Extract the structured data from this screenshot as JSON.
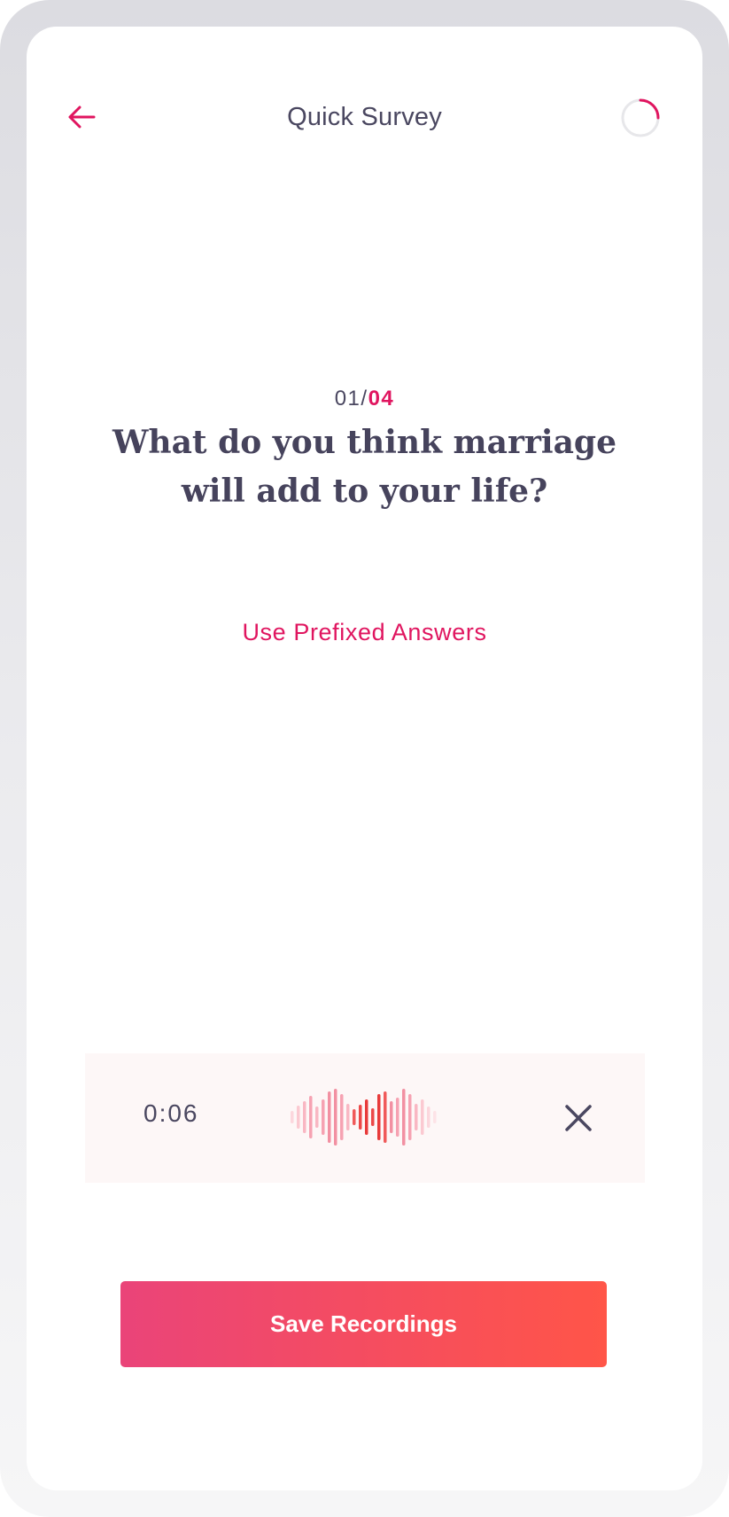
{
  "header": {
    "title": "Quick Survey",
    "back_icon": "arrow-left-icon",
    "progress_icon": "progress-ring-icon",
    "progress_fraction": 0.25
  },
  "question": {
    "current": "01/",
    "total": "04",
    "text": "What do you think marriage will add to your life?"
  },
  "prefixed_link": "Use Prefixed Answers",
  "recording": {
    "time": "0:06",
    "waveform_icon": "audio-waveform-icon",
    "close_icon": "close-icon"
  },
  "save_button": "Save Recordings",
  "colors": {
    "accent": "#e0155f",
    "text": "#4a4760",
    "button_start": "#ea4479",
    "button_end": "#ff5548"
  }
}
